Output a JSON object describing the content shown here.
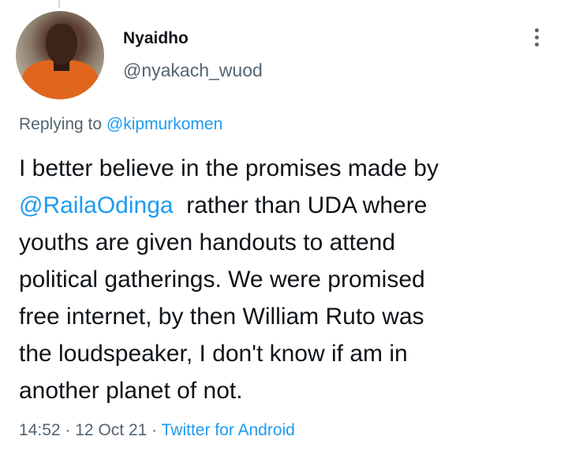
{
  "tweet": {
    "author": {
      "name": "Nyaidho",
      "handle": "@nyakach_wuod"
    },
    "replying_prefix": "Replying to",
    "replying_to": "@kipmurkomen",
    "body": {
      "line1": "I better believe in the promises made by",
      "line2_mention": "@RailaOdinga",
      "line2_rest": "  rather than UDA where",
      "line3": "youths are given handouts to attend",
      "line4": "political gatherings. We were promised",
      "line5": "free internet, by then William Ruto was",
      "line6": "the loudspeaker, I don't know if am in",
      "line7": "another planet of not."
    },
    "time": "14:52",
    "separator": "·",
    "date": "12 Oct 21",
    "source": "Twitter for Android",
    "colors": {
      "link": "#1d9bf0",
      "secondary_text": "#536471",
      "primary_text": "#0f1419"
    },
    "icons": {
      "more": "more-vertical-icon"
    }
  }
}
